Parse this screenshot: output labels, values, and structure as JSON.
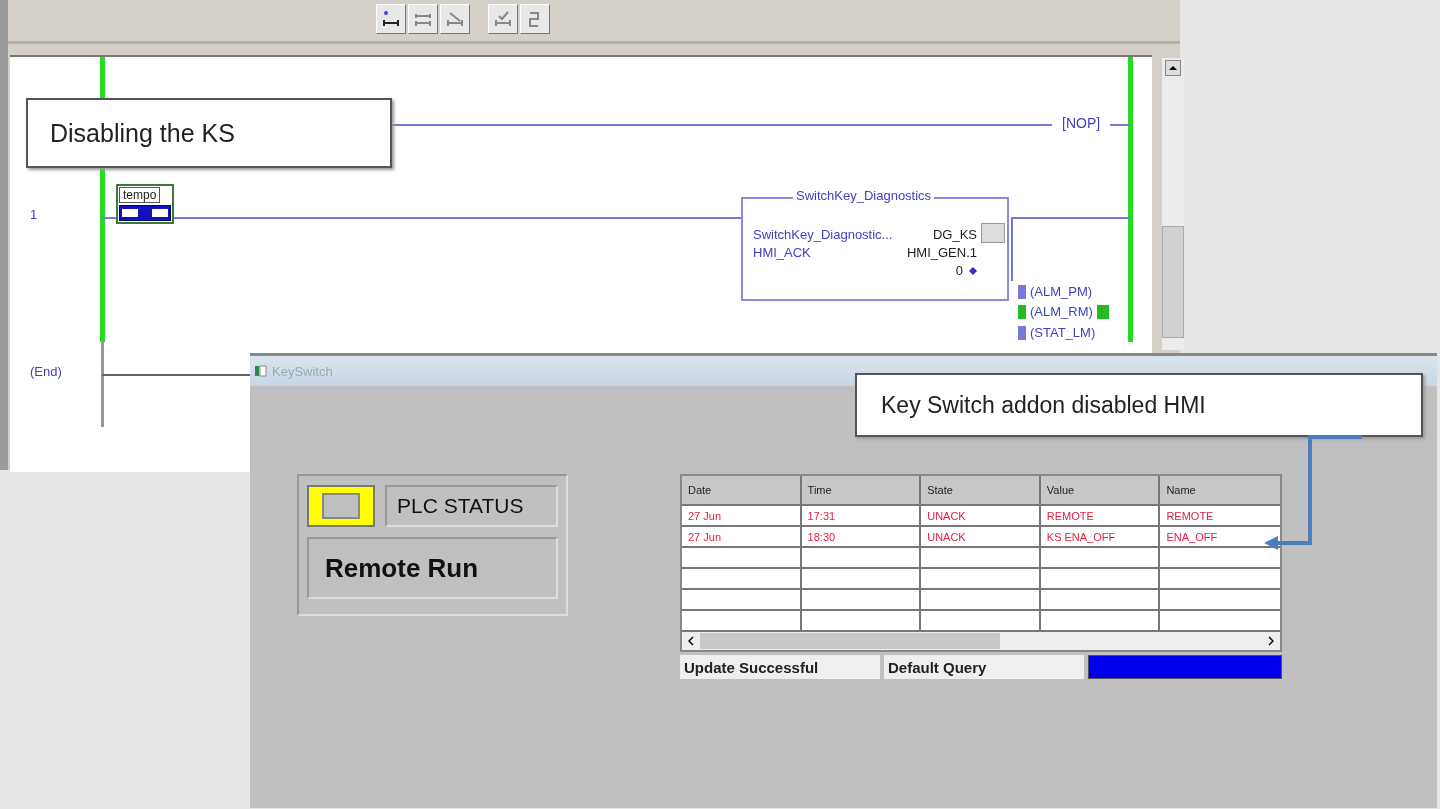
{
  "ladder": {
    "callout": "Disabling the KS",
    "rung_0": {
      "output": "[NOP]"
    },
    "rung_1": {
      "number": "1",
      "contact": {
        "tag": "tempo",
        "energized": true
      },
      "block": {
        "title": "SwitchKey_Diagnostics",
        "rows": [
          {
            "kind": "button",
            "param": "SwitchKey_Diagnostic...",
            "value": "DG_KS"
          },
          {
            "kind": "plain",
            "param": "HMI_ACK",
            "value": "HMI_GEN.1"
          },
          {
            "kind": "output",
            "value": "0"
          }
        ]
      },
      "coils": [
        {
          "label": "(ALM_PM)",
          "energized": false
        },
        {
          "label": "(ALM_RM)",
          "energized": true
        },
        {
          "label": "(STAT_LM)",
          "energized": false
        }
      ]
    },
    "end_rung": {
      "number": "(End)"
    }
  },
  "hmi": {
    "title": "KeySwitch",
    "callout": "Key Switch addon disabled HMI",
    "status_panel": {
      "indicator_on": true,
      "label": "PLC STATUS",
      "mode": "Remote Run"
    },
    "table": {
      "columns": [
        "Date",
        "Time",
        "State",
        "Value",
        "Name"
      ],
      "rows": [
        [
          "27 Jun",
          "17:31",
          "UNACK",
          "REMOTE",
          "REMOTE"
        ],
        [
          "27 Jun",
          "18:30",
          "UNACK",
          "KS ENA_OFF",
          "ENA_OFF"
        ]
      ]
    },
    "status_bar": {
      "message": "Update Successful",
      "query": "Default Query"
    }
  }
}
